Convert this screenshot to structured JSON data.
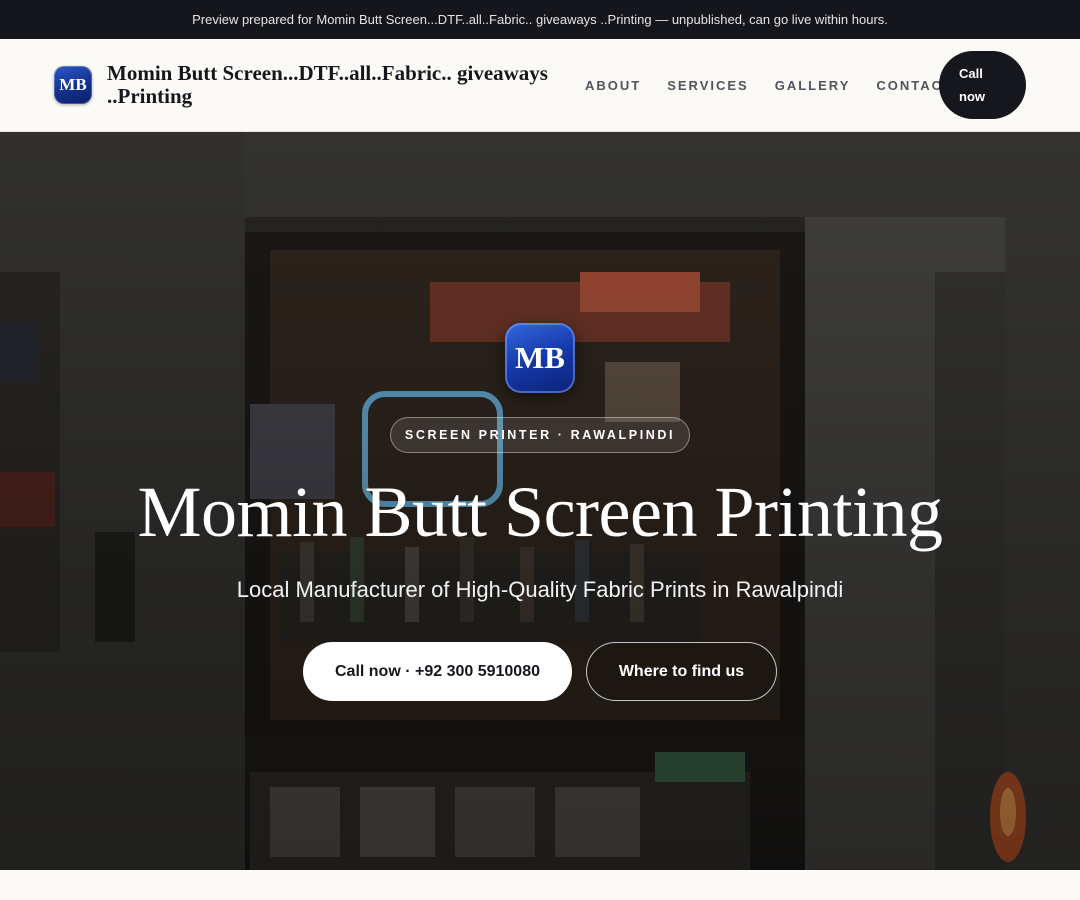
{
  "preview_banner": {
    "text": "Preview prepared for Momin Butt Screen...DTF..all..Fabric.. giveaways ..Printing — unpublished, can go live within hours."
  },
  "header": {
    "logo_initials": "MB",
    "brand_name": "Momin Butt Screen...DTF..all..Fabric.. giveaways ..Printing",
    "nav": [
      {
        "label": "ABOUT"
      },
      {
        "label": "SERVICES"
      },
      {
        "label": "GALLERY"
      },
      {
        "label": "CONTACT"
      }
    ],
    "cta_label": "Call now"
  },
  "hero": {
    "logo_initials": "MB",
    "eyebrow": "SCREEN PRINTER · RAWALPINDI",
    "title": "Momin Butt Screen Printing",
    "subtitle": "Local Manufacturer of High-Quality Fabric Prints in Rawalpindi",
    "primary_button": "Call now · +92 300 5910080",
    "secondary_button": "Where to find us"
  },
  "colors": {
    "banner_bg": "#15161c",
    "page_bg": "#fbfaf7",
    "ink": "#16171d",
    "logo_blue": "#1539a8"
  }
}
